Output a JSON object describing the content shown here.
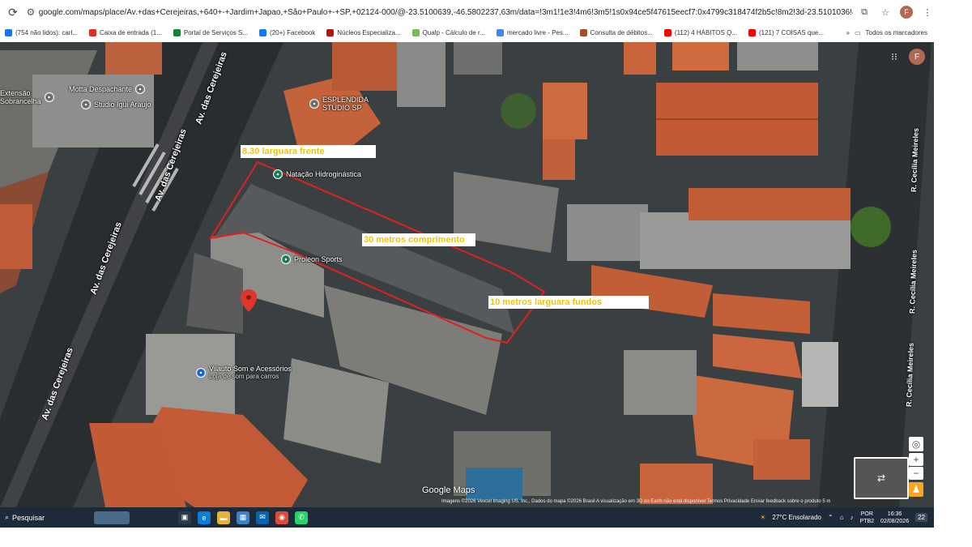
{
  "browser": {
    "url": "google.com/maps/place/Av.+das+Cerejeiras,+640+-+Jardim+Japao,+São+Paulo+-+SP,+02124-000/@-23.5100639,-46.5802237,63m/data=!3m1!1e3!4m6!3m5!1s0x94ce5f47615eecf7:0x4799c318474f2b5c!8m2!3d-23.5101036!4d-46.5804879!16s%2Fg%2F11...",
    "profile_initial": "F",
    "bookmarks": [
      {
        "label": "(754 não lidos): carl...",
        "icon": "mail-icon",
        "color": "#1a73e8"
      },
      {
        "label": "Caixa de entrada (1...",
        "icon": "gmail-icon",
        "color": "#d93025"
      },
      {
        "label": "Portal de Serviços S...",
        "icon": "portal-icon",
        "color": "#188038"
      },
      {
        "label": "(20+) Facebook",
        "icon": "facebook-icon",
        "color": "#1877f2"
      },
      {
        "label": "Núcleos Especializa...",
        "icon": "nucleos-icon",
        "color": "#b31412"
      },
      {
        "label": "Qualp - Cálculo de r...",
        "icon": "qualp-icon",
        "color": "#7b5"
      },
      {
        "label": "mercado livre - Pes...",
        "icon": "google-icon",
        "color": "#4285f4"
      },
      {
        "label": "Consulta de débitos...",
        "icon": "consulta-icon",
        "color": "#a0522d"
      },
      {
        "label": "(112) 4 HÁBITOS Q...",
        "icon": "youtube-icon",
        "color": "#ff0000"
      },
      {
        "label": "(121) 7 COISAS que...",
        "icon": "youtube-icon",
        "color": "#ff0000"
      }
    ],
    "all_bookmarks": "Todos os marcadores"
  },
  "map": {
    "annotations": {
      "front_width": "8.30 larguara frente",
      "length": "30 metros comprimento",
      "back_width": "10 metros larguara fundos"
    },
    "pois": [
      {
        "label": "ESPLENDIDA STUDIO SP",
        "icon": "place-icon"
      },
      {
        "label": "Natação Hidroginástica",
        "icon": "pool-icon"
      },
      {
        "label": "Proleon Sports",
        "icon": "sports-icon"
      },
      {
        "label": "Motta Despachante",
        "icon": "place-icon"
      },
      {
        "label": "Studio Igui Araujo",
        "icon": "place-icon"
      },
      {
        "label": "Vilauto Som e Acessórios",
        "sub": "Loja de som para carros",
        "icon": "shopping-icon"
      },
      {
        "label": "Extensão",
        "sub": "Sobrancelha",
        "icon": "place-icon"
      }
    ],
    "streets": {
      "main": "Av. das Cerejeiras",
      "side": "R. Cecília Meireles"
    },
    "attribution": "Imagens ©2026 Vexcel Imaging US, Inc., Dados do mapa ©2026    Brasil    A visualização em 3D do Earth não está disponível    Termos    Privacidade    Enviar feedback sobre o produto    5 m",
    "logo": "Google Maps"
  },
  "taskbar": {
    "search": "Pesquisar",
    "weather": "27°C  Ensolarado",
    "lang": "POR",
    "layout": "PTB2",
    "time": "16:36",
    "date": "02/08/2026",
    "notifications": "22"
  }
}
